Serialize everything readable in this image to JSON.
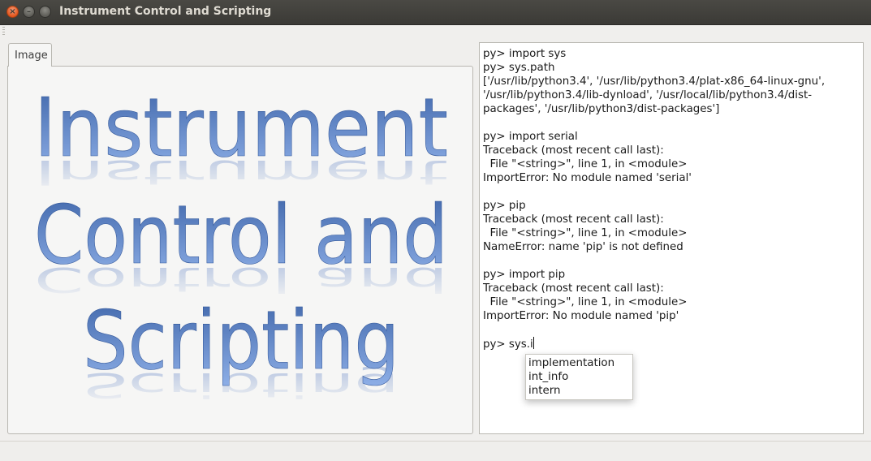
{
  "window": {
    "title": "Instrument Control and Scripting",
    "close_glyph": "×",
    "min_glyph": "–",
    "max_glyph": ""
  },
  "tabs": [
    {
      "label": "Image"
    }
  ],
  "logo": {
    "lines": [
      "Instrument",
      "Control and",
      "Scripting"
    ],
    "colors": {
      "top": "#3d64a8",
      "bottom": "#8fb0e8",
      "reflection": "#9fb3d9"
    }
  },
  "console": {
    "lines": [
      "py> import sys",
      "py> sys.path",
      "['/usr/lib/python3.4', '/usr/lib/python3.4/plat-x86_64-linux-gnu', '/usr/lib/python3.4/lib-dynload', '/usr/local/lib/python3.4/dist-packages', '/usr/lib/python3/dist-packages']",
      "",
      "py> import serial",
      "Traceback (most recent call last):",
      "  File \"<string>\", line 1, in <module>",
      "ImportError: No module named 'serial'",
      "",
      "py> pip",
      "Traceback (most recent call last):",
      "  File \"<string>\", line 1, in <module>",
      "NameError: name 'pip' is not defined",
      "",
      "py> import pip",
      "Traceback (most recent call last):",
      "  File \"<string>\", line 1, in <module>",
      "ImportError: No module named 'pip'",
      ""
    ],
    "current_input": "py> sys.i"
  },
  "completer": {
    "items": [
      "implementation",
      "int_info",
      "intern"
    ]
  }
}
